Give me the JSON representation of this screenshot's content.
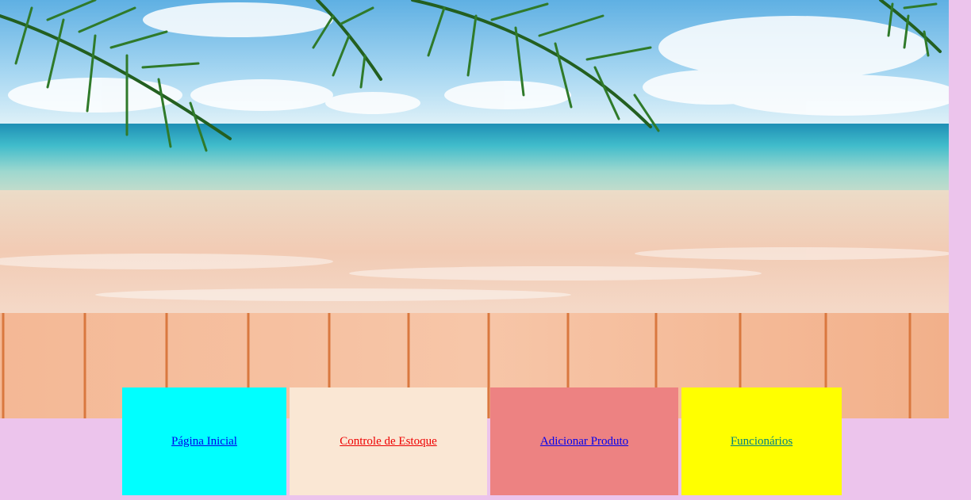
{
  "nav": {
    "items": [
      {
        "label": "Página Inicial",
        "bg": "#00ffff",
        "color": "#0000ee"
      },
      {
        "label": "Controle de Estoque",
        "bg": "#fae7d4",
        "color": "#ee0000"
      },
      {
        "label": "Adicionar Produto",
        "bg": "#ed8282",
        "color": "#0000ee"
      },
      {
        "label": "Funcionários",
        "bg": "#ffff00",
        "color": "#008080"
      }
    ]
  },
  "colors": {
    "page_bg": "#ecc4ec",
    "sky": "#7fc4ea",
    "sea": "#49b7c9",
    "sand": "#f3d2bd",
    "deck": "#f0b48e"
  }
}
